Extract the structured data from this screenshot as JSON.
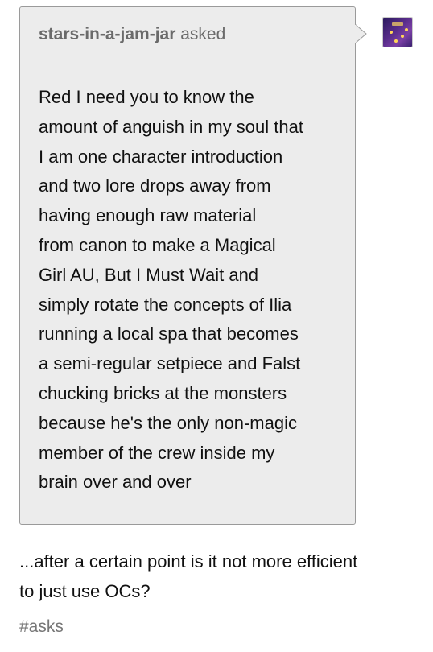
{
  "ask": {
    "asker_name": "stars-in-a-jam-jar",
    "asked_label": "asked",
    "body_lines": [
      "Red I need you to know the",
      "amount of anguish in my soul that",
      "I am one character introduction",
      "and two lore drops away from",
      "having enough raw material",
      "from canon to make a Magical",
      "Girl AU, But I Must Wait and",
      "simply rotate the concepts of Ilia",
      "running a local spa that becomes",
      "a semi-regular setpiece and Falst",
      "chucking bricks at the monsters",
      "because he's the only non-magic",
      "member of the crew inside my",
      "brain over and over"
    ],
    "avatar_icon": "avatar-icon"
  },
  "answer": {
    "lines": [
      "...after a certain point is it not more efficient",
      "to just use OCs?"
    ]
  },
  "tags": [
    "#asks"
  ],
  "colors": {
    "bubble_background": "#ececec",
    "bubble_border": "#9a9a9a",
    "asker_text": "#6a6a6a",
    "body_text": "#111111",
    "tag_text": "#777777"
  }
}
